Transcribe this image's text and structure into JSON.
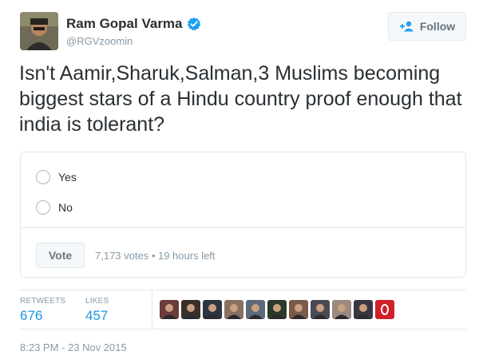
{
  "user": {
    "name": "Ram Gopal Varma",
    "handle": "@RGVzoomin",
    "verified_icon": "verified-badge-icon"
  },
  "follow_button": {
    "label": "Follow",
    "icon": "follow-person-plus-icon"
  },
  "tweet": {
    "text": "Isn't Aamir,Sharuk,Salman,3 Muslims becoming biggest stars of a Hindu country proof enough that india is tolerant?"
  },
  "poll": {
    "options": [
      {
        "label": "Yes"
      },
      {
        "label": "No"
      }
    ],
    "vote_label": "Vote",
    "meta": "7,173 votes • 19 hours left"
  },
  "stats": {
    "retweets_label": "RETWEETS",
    "retweets_value": "676",
    "likes_label": "LIKES",
    "likes_value": "457"
  },
  "liker_avatars": [
    {
      "color": "#6b3b3b"
    },
    {
      "color": "#3a2e2a"
    },
    {
      "color": "#2f3540"
    },
    {
      "color": "#8a7060"
    },
    {
      "color": "#5b6a78"
    },
    {
      "color": "#2c3a2c"
    },
    {
      "color": "#7a5a48"
    },
    {
      "color": "#4a4a55"
    },
    {
      "color": "#9a8a80"
    },
    {
      "color": "#3a3640"
    },
    {
      "color": "#d0202a"
    }
  ],
  "timestamp": "8:23 PM - 23 Nov 2015",
  "colors": {
    "link_blue": "#1b95e0",
    "verified_blue": "#1da1f2",
    "muted": "#8899a6",
    "border": "#e1e8ed"
  }
}
